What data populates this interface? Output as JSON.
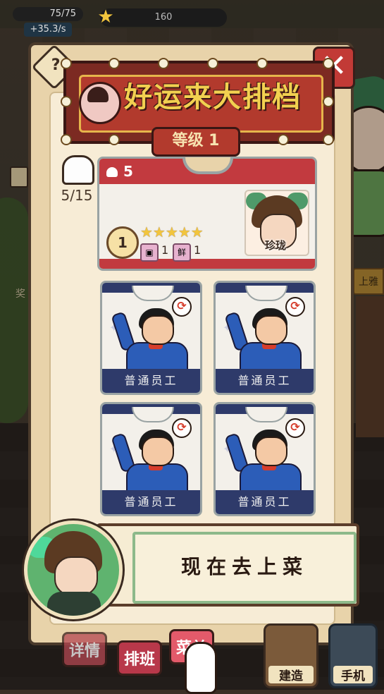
{
  "hud": {
    "energy": "75/75",
    "income_rate": "+35.3/s",
    "coins": "160"
  },
  "panel": {
    "shop_name": "好运来大排档",
    "level": "等级 1",
    "staff_count": "5/15",
    "help_symbol": "?",
    "close_symbol": "✕"
  },
  "top_card": {
    "chef_level": "5",
    "level": "1",
    "stars": "★★★★★",
    "skill1_value": "1",
    "skill2_icon_label": "鲜",
    "skill2_value": "1",
    "chef_name": "珍珑"
  },
  "workers": [
    {
      "label": "普通员工"
    },
    {
      "label": "普通员工"
    },
    {
      "label": "普通员工"
    },
    {
      "label": "普通员工"
    }
  ],
  "dialog": {
    "text": "现在去上菜"
  },
  "tabs": {
    "details": "详情",
    "schedule": "排班",
    "menu": "菜单"
  },
  "buttons": {
    "build": "建造",
    "phone": "手机"
  },
  "side": {
    "sign": "上雅",
    "left_mark": "奖"
  },
  "icons": {
    "star": "star-icon",
    "chef_hat": "chef-hat-icon",
    "swap": "swap-icon",
    "close": "close-icon",
    "help": "help-icon",
    "hand": "pointing-hand-icon"
  }
}
